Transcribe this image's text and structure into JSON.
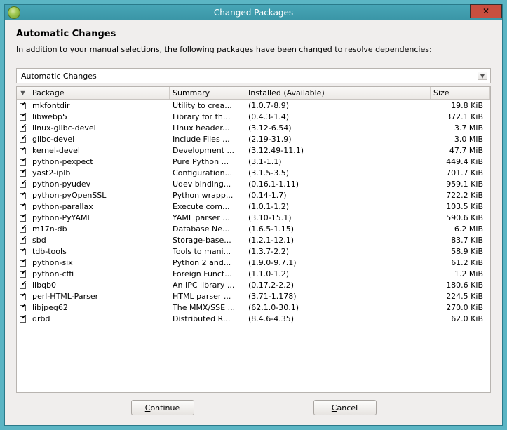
{
  "window": {
    "title": "Changed Packages"
  },
  "heading": "Automatic Changes",
  "subheading": "In addition to your manual selections, the following packages have been changed to resolve dependencies:",
  "dropdown": {
    "value": "Automatic Changes"
  },
  "columns": {
    "package": "Package",
    "summary": "Summary",
    "installed": "Installed (Available)",
    "size": "Size"
  },
  "rows": [
    {
      "pkg": "mkfontdir",
      "sum": "Utility to crea...",
      "inst": "(1.0.7-8.9)",
      "size": "19.8 KiB"
    },
    {
      "pkg": "libwebp5",
      "sum": "Library for th...",
      "inst": "(0.4.3-1.4)",
      "size": "372.1 KiB"
    },
    {
      "pkg": "linux-glibc-devel",
      "sum": "Linux header...",
      "inst": "(3.12-6.54)",
      "size": "3.7 MiB"
    },
    {
      "pkg": "glibc-devel",
      "sum": "Include Files ...",
      "inst": "(2.19-31.9)",
      "size": "3.0 MiB"
    },
    {
      "pkg": "kernel-devel",
      "sum": "Development ...",
      "inst": "(3.12.49-11.1)",
      "size": "47.7 MiB"
    },
    {
      "pkg": "python-pexpect",
      "sum": "Pure Python ...",
      "inst": "(3.1-1.1)",
      "size": "449.4 KiB"
    },
    {
      "pkg": "yast2-iplb",
      "sum": "Configuration...",
      "inst": "(3.1.5-3.5)",
      "size": "701.7 KiB"
    },
    {
      "pkg": "python-pyudev",
      "sum": "Udev binding...",
      "inst": "(0.16.1-1.11)",
      "size": "959.1 KiB"
    },
    {
      "pkg": "python-pyOpenSSL",
      "sum": "Python wrapp...",
      "inst": "(0.14-1.7)",
      "size": "722.2 KiB"
    },
    {
      "pkg": "python-parallax",
      "sum": "Execute com...",
      "inst": "(1.0.1-1.2)",
      "size": "103.5 KiB"
    },
    {
      "pkg": "python-PyYAML",
      "sum": "YAML parser ...",
      "inst": "(3.10-15.1)",
      "size": "590.6 KiB"
    },
    {
      "pkg": "m17n-db",
      "sum": "Database Ne...",
      "inst": "(1.6.5-1.15)",
      "size": "6.2 MiB"
    },
    {
      "pkg": "sbd",
      "sum": "Storage-base...",
      "inst": "(1.2.1-12.1)",
      "size": "83.7 KiB"
    },
    {
      "pkg": "tdb-tools",
      "sum": "Tools to mani...",
      "inst": "(1.3.7-2.2)",
      "size": "58.9 KiB"
    },
    {
      "pkg": "python-six",
      "sum": "Python 2 and...",
      "inst": "(1.9.0-9.7.1)",
      "size": "61.2 KiB"
    },
    {
      "pkg": "python-cffi",
      "sum": "Foreign Funct...",
      "inst": "(1.1.0-1.2)",
      "size": "1.2 MiB"
    },
    {
      "pkg": "libqb0",
      "sum": "An IPC library ...",
      "inst": "(0.17.2-2.2)",
      "size": "180.6 KiB"
    },
    {
      "pkg": "perl-HTML-Parser",
      "sum": "HTML parser ...",
      "inst": "(3.71-1.178)",
      "size": "224.5 KiB"
    },
    {
      "pkg": "libjpeg62",
      "sum": "The MMX/SSE ...",
      "inst": "(62.1.0-30.1)",
      "size": "270.0 KiB"
    },
    {
      "pkg": "drbd",
      "sum": "Distributed R...",
      "inst": "(8.4.6-4.35)",
      "size": "62.0 KiB"
    }
  ],
  "buttons": {
    "continue_pre": "C",
    "continue_post": "ontinue",
    "cancel_pre": "C",
    "cancel_post": "ancel"
  }
}
